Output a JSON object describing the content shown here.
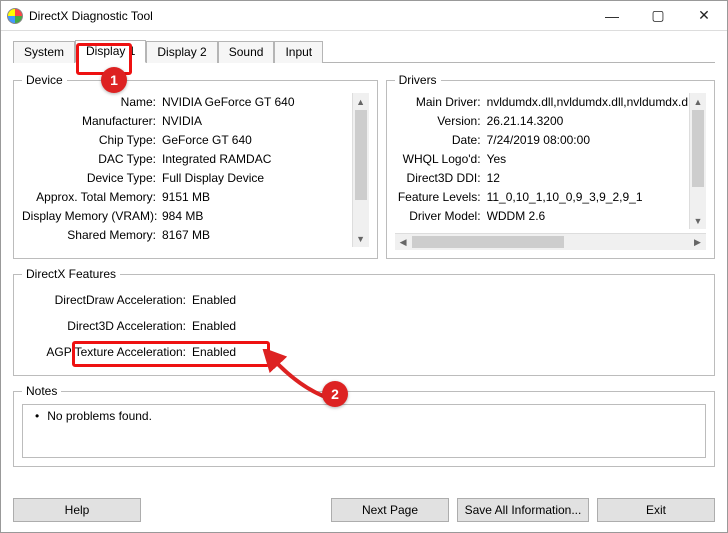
{
  "window": {
    "title": "DirectX Diagnostic Tool",
    "min_tooltip": "Minimize",
    "max_tooltip": "Maximize",
    "close_tooltip": "Close"
  },
  "tabs": {
    "system": "System",
    "display1": "Display 1",
    "display2": "Display 2",
    "sound": "Sound",
    "input": "Input",
    "active": "display1"
  },
  "device": {
    "legend": "Device",
    "rows": [
      {
        "k": "Name:",
        "v": "NVIDIA GeForce GT 640"
      },
      {
        "k": "Manufacturer:",
        "v": "NVIDIA"
      },
      {
        "k": "Chip Type:",
        "v": "GeForce GT 640"
      },
      {
        "k": "DAC Type:",
        "v": "Integrated RAMDAC"
      },
      {
        "k": "Device Type:",
        "v": "Full Display Device"
      },
      {
        "k": "Approx. Total Memory:",
        "v": "9151 MB"
      },
      {
        "k": "Display Memory (VRAM):",
        "v": "984 MB"
      },
      {
        "k": "Shared Memory:",
        "v": "8167 MB"
      }
    ]
  },
  "drivers": {
    "legend": "Drivers",
    "rows": [
      {
        "k": "Main Driver:",
        "v": "nvldumdx.dll,nvldumdx.dll,nvldumdx.d"
      },
      {
        "k": "Version:",
        "v": "26.21.14.3200"
      },
      {
        "k": "Date:",
        "v": "7/24/2019 08:00:00"
      },
      {
        "k": "WHQL Logo'd:",
        "v": "Yes"
      },
      {
        "k": "Direct3D DDI:",
        "v": "12"
      },
      {
        "k": "Feature Levels:",
        "v": "11_0,10_1,10_0,9_3,9_2,9_1"
      },
      {
        "k": "Driver Model:",
        "v": "WDDM 2.6"
      }
    ]
  },
  "features": {
    "legend": "DirectX Features",
    "rows": [
      {
        "k": "DirectDraw Acceleration:",
        "v": "Enabled"
      },
      {
        "k": "Direct3D Acceleration:",
        "v": "Enabled"
      },
      {
        "k": "AGP Texture Acceleration:",
        "v": "Enabled"
      }
    ]
  },
  "notes": {
    "legend": "Notes",
    "text": "No problems found."
  },
  "buttons": {
    "help": "Help",
    "next": "Next Page",
    "save": "Save All Information...",
    "exit": "Exit"
  },
  "annotations": {
    "n1": "1",
    "n2": "2"
  }
}
